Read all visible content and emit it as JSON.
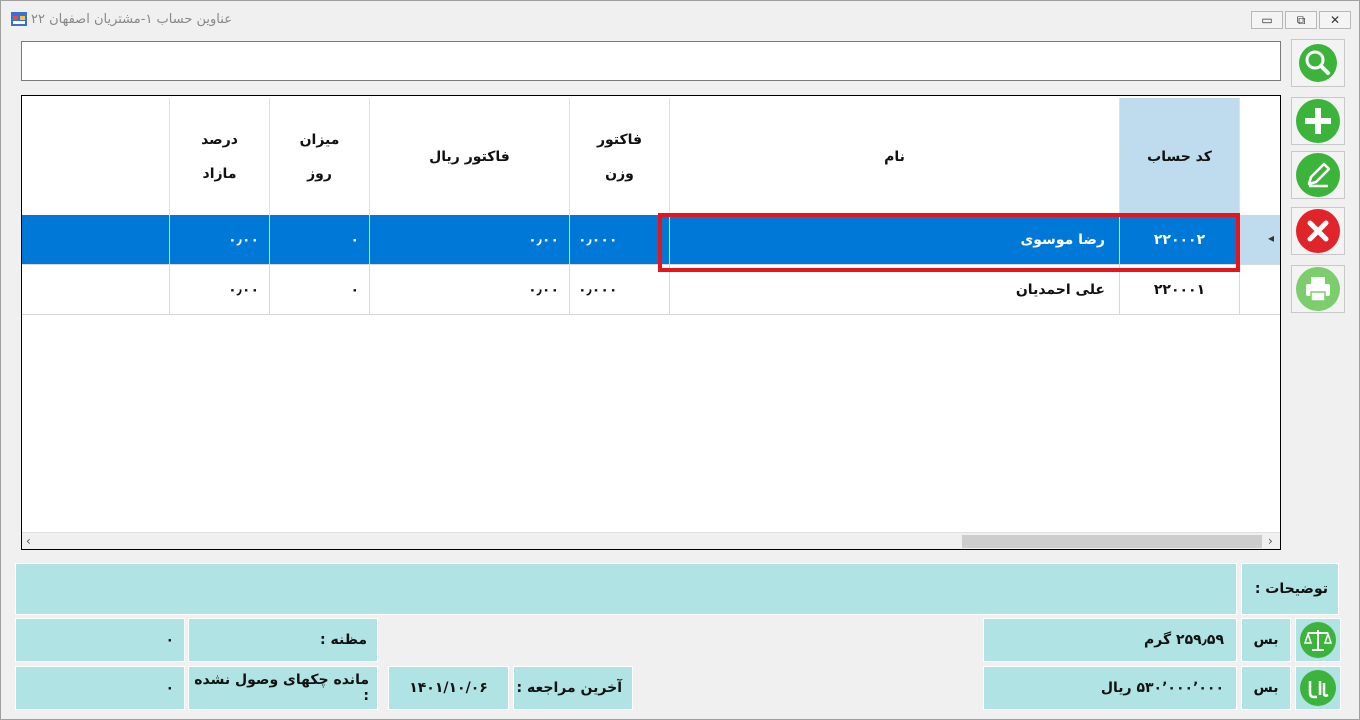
{
  "window": {
    "title": "عناوین حساب ۱-مشتریان اصفهان ۲۲",
    "minimize": "▭",
    "restore": "⧉",
    "close": "✕"
  },
  "search": {
    "value": "",
    "placeholder": ""
  },
  "toolbar": {
    "search_icon": "search-icon",
    "add_icon": "add-icon",
    "edit_icon": "edit-icon",
    "delete_icon": "delete-icon",
    "print_icon": "print-icon"
  },
  "grid": {
    "columns": {
      "code": "کد حساب",
      "name": "نام",
      "weight_factor_1": "فاکتور",
      "weight_factor_2": "وزن",
      "rial_factor": "فاکتور ریال",
      "day_amount_1": "میزان",
      "day_amount_2": "روز",
      "surplus_percent_1": "درصد",
      "surplus_percent_2": "مازاد"
    },
    "rows": [
      {
        "code": "۲۲۰۰۰۲",
        "name": "رضا موسوی",
        "weight_factor": "۰٫۰۰۰",
        "rial_factor": "۰٫۰۰",
        "day_amount": "۰",
        "surplus_percent": "۰٫۰۰"
      },
      {
        "code": "۲۲۰۰۰۱",
        "name": "علی احمدیان",
        "weight_factor": "۰٫۰۰۰",
        "rial_factor": "۰٫۰۰",
        "day_amount": "۰",
        "surplus_percent": "۰٫۰۰"
      }
    ],
    "row_indicator": "◂"
  },
  "footer": {
    "description_label": "توضیحات :",
    "description_value": "",
    "weight_unit_label": "بس",
    "weight_value": "۲۵۹٫۵۹  گرم",
    "rial_unit_label": "بس",
    "rial_value": "۵۳۰٬۰۰۰٬۰۰۰  ریال",
    "suspect_label": "مظنه :",
    "suspect_value": "۰",
    "cheque_label": "مانده چکهای وصول نشده :",
    "cheque_value": "۰",
    "last_visit_label": "آخرین مراجعه :",
    "last_visit_value": "۱۴۰۱/۱۰/۰۶",
    "scale_icon": "scale-icon",
    "rial_icon": "rial-icon"
  },
  "colors": {
    "selection": "#0078d7",
    "header_selected": "#bfdcef",
    "panel": "#b0e3e3",
    "highlight": "#e8141c",
    "button_green": "#3cb43c",
    "button_red": "#e0242a"
  }
}
